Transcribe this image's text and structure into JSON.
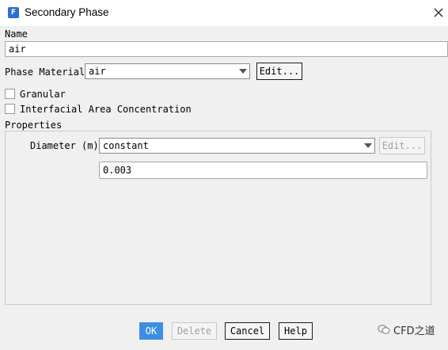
{
  "window": {
    "title": "Secondary Phase"
  },
  "name": {
    "label": "Name",
    "value": "air"
  },
  "phase_material": {
    "label": "Phase Material",
    "value": "air",
    "edit_label": "Edit..."
  },
  "options": {
    "granular_label": "Granular",
    "granular_checked": false,
    "iac_label": "Interfacial Area Concentration",
    "iac_checked": false
  },
  "properties": {
    "section_label": "Properties",
    "diameter_label": "Diameter (m)",
    "diameter_method": "constant",
    "diameter_edit_label": "Edit...",
    "diameter_value": "0.003"
  },
  "footer": {
    "ok_label": "OK",
    "delete_label": "Delete",
    "cancel_label": "Cancel",
    "help_label": "Help"
  },
  "watermark": {
    "text": "CFD之道"
  }
}
